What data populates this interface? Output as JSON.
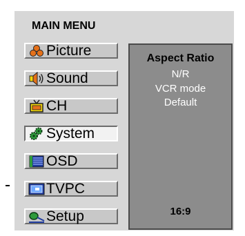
{
  "menu": {
    "title": "MAIN MENU",
    "items": [
      {
        "label": "Picture",
        "icon": "picture-icon",
        "selected": false
      },
      {
        "label": "Sound",
        "icon": "speaker-icon",
        "selected": false
      },
      {
        "label": "CH",
        "icon": "tv-antenna-icon",
        "selected": false
      },
      {
        "label": "System",
        "icon": "gears-icon",
        "selected": true
      },
      {
        "label": "OSD",
        "icon": "osd-lines-icon",
        "selected": false
      },
      {
        "label": "TVPC",
        "icon": "monitor-icon",
        "selected": false
      },
      {
        "label": "Setup",
        "icon": "setup-icon",
        "selected": false
      }
    ]
  },
  "submenu": {
    "title": "Aspect Ratio",
    "options": [
      "N/R",
      "VCR mode",
      "Default"
    ],
    "value": "16:9"
  },
  "colors": {
    "panel": "#d7d7d7",
    "submenu_bg": "#8c8c8c",
    "option_text": "#ffffff",
    "icon_orange": "#e5711a",
    "icon_yellow": "#f3d50a",
    "icon_green": "#2e9a3b",
    "icon_blue": "#1e3b9e"
  }
}
